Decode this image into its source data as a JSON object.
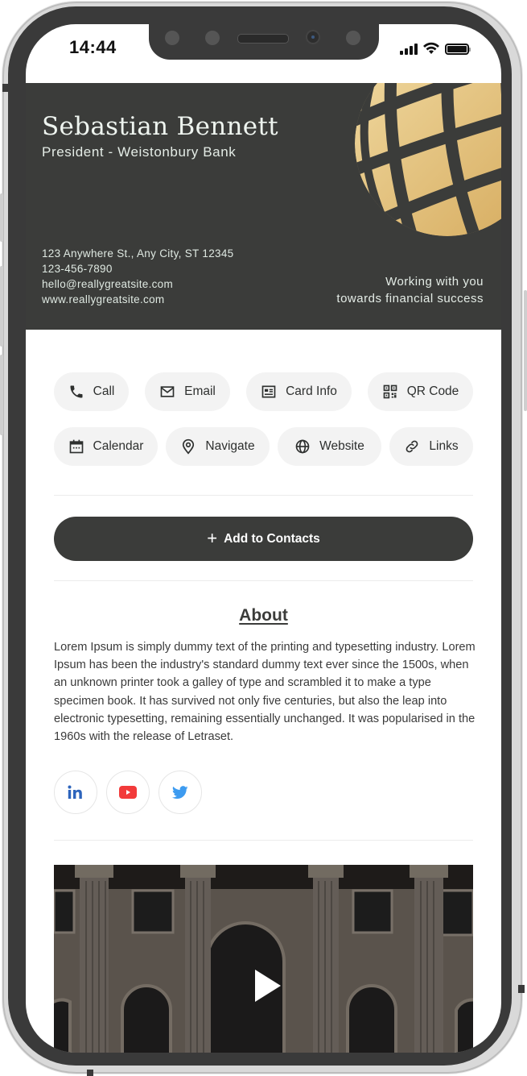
{
  "status_bar": {
    "time": "14:44",
    "icons": [
      "signal-icon",
      "wifi-icon",
      "battery-icon"
    ]
  },
  "card": {
    "name": "Sebastian Bennett",
    "role": "President - Weistonbury Bank",
    "address": "123 Anywhere St., Any City, ST 12345",
    "phone": "123-456-7890",
    "email": "hello@reallygreatsite.com",
    "website": "www.reallygreatsite.com",
    "tagline_line1": "Working with you",
    "tagline_line2": "towards financial success",
    "logo_icon": "globe-icon",
    "colors": {
      "background": "#3b3c3a",
      "gold": "#e2c27f",
      "text": "#e4ece6"
    }
  },
  "actions": [
    {
      "label": "Call",
      "icon": "phone-icon"
    },
    {
      "label": "Email",
      "icon": "mail-icon"
    },
    {
      "label": "Card Info",
      "icon": "card-info-icon"
    },
    {
      "label": "QR Code",
      "icon": "qr-code-icon"
    },
    {
      "label": "Calendar",
      "icon": "calendar-icon"
    },
    {
      "label": "Navigate",
      "icon": "location-pin-icon"
    },
    {
      "label": "Website",
      "icon": "globe-icon"
    },
    {
      "label": "Links",
      "icon": "link-icon"
    }
  ],
  "add_contacts": {
    "label": "Add to Contacts",
    "icon": "plus-icon"
  },
  "about": {
    "title": "About",
    "text": "Lorem Ipsum is simply dummy text of the printing and typesetting industry. Lorem Ipsum has been the industry's standard dummy text ever since the 1500s, when an unknown printer took a galley of type and scrambled it to make a type specimen book. It has survived not only five centuries, but also the leap into electronic typesetting, remaining essentially unchanged. It was popularised in the 1960s with the release of Letraset."
  },
  "social": [
    {
      "name": "LinkedIn",
      "icon": "linkedin-icon",
      "color": "#2d64bc"
    },
    {
      "name": "YouTube",
      "icon": "youtube-icon",
      "color": "#f23a3a"
    },
    {
      "name": "Twitter",
      "icon": "twitter-icon",
      "color": "#3d9bf0"
    }
  ],
  "video": {
    "icon": "play-icon"
  },
  "theme": {
    "primary": "#3b3c3a",
    "pill_bg": "#f3f3f3",
    "divider": "#ececec"
  }
}
